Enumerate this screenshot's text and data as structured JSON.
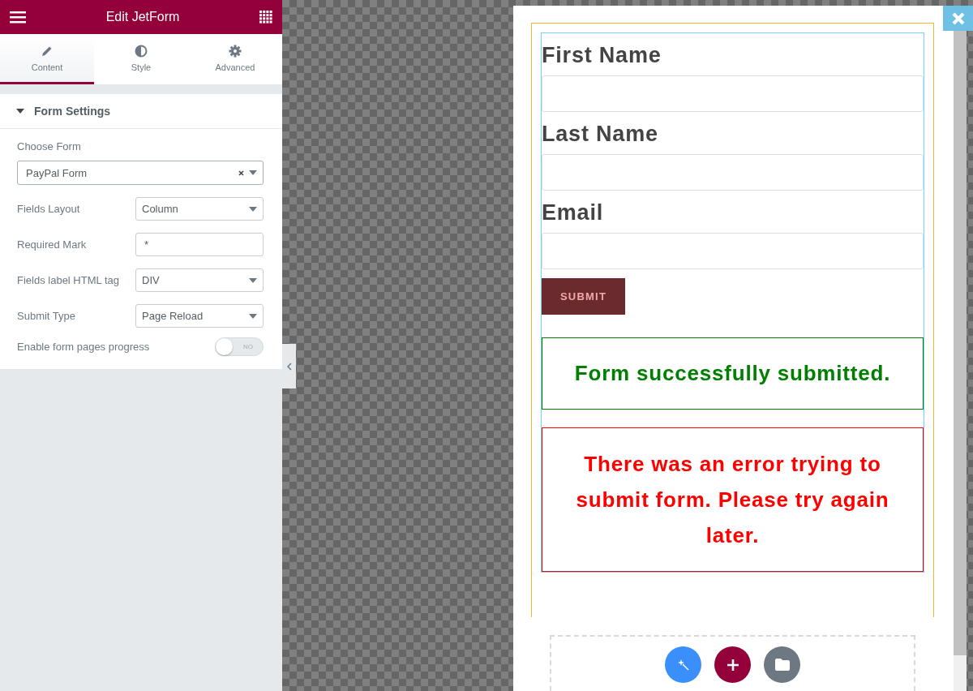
{
  "window": {
    "title": "Edit JetForm"
  },
  "tabs": [
    {
      "label": "Content",
      "kind": "pencil",
      "selected": true
    },
    {
      "label": "Style",
      "kind": "contrast",
      "selected": false
    },
    {
      "label": "Advanced",
      "kind": "gear",
      "selected": false
    }
  ],
  "section": {
    "title": "Form Settings",
    "expanded": true
  },
  "controls": [
    {
      "kind": "select-wide",
      "label": "Choose Form",
      "value": "PayPal Form",
      "clearable": true
    },
    {
      "kind": "select",
      "label": "Fields Layout",
      "value": "Column"
    },
    {
      "kind": "text",
      "label": "Required Mark",
      "value": "*"
    },
    {
      "kind": "select",
      "label": "Fields label HTML tag",
      "value": "DIV"
    },
    {
      "kind": "select",
      "label": "Submit Type",
      "value": "Page Reload"
    },
    {
      "kind": "switch",
      "label": "Enable form pages progress",
      "on": false,
      "state_text": "NO"
    }
  ],
  "form": {
    "fields": [
      {
        "label": "First Name"
      },
      {
        "label": "Last Name"
      },
      {
        "label": "Email"
      }
    ],
    "submit": "SUBMIT",
    "messages": [
      {
        "kind": "success",
        "text": "Form successfully submitted."
      },
      {
        "kind": "error",
        "text": "There was an error trying to submit form. Please try again later."
      }
    ]
  }
}
